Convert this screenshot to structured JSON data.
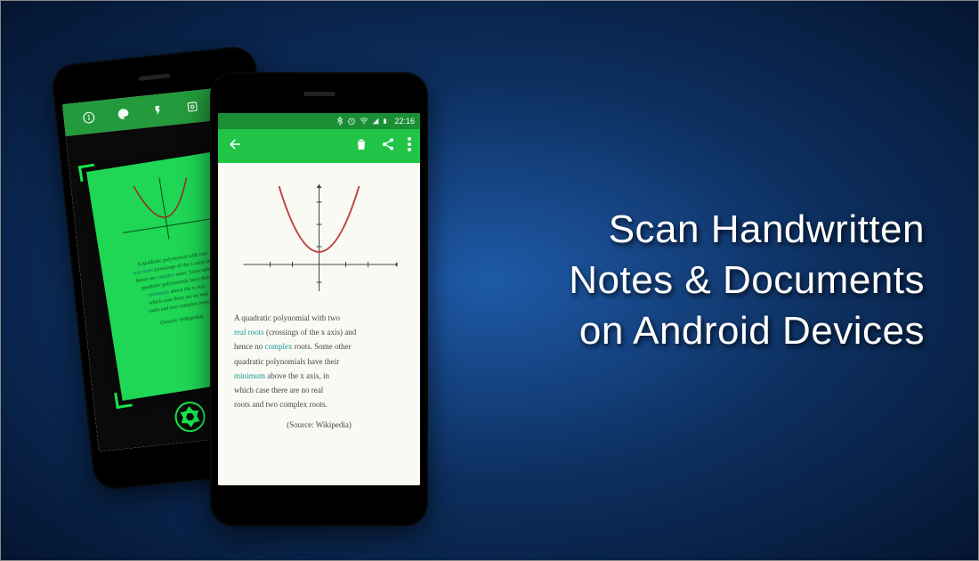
{
  "headline": {
    "line1": "Scan Handwritten",
    "line2": "Notes & Documents",
    "line3": "on Android Devices"
  },
  "phone1": {
    "note_l1": "A quadratic polynomial with two",
    "note_l2a": "real roots",
    "note_l2b": " (crossings of the x axis) and",
    "note_l3a": "hence no ",
    "note_l3b": "complex",
    "note_l3c": " roots. Some other",
    "note_l4": "quadratic polynomials have their",
    "note_l5a": "minimum",
    "note_l5b": " above the x axis,",
    "note_l6": "which case there are no real",
    "note_l7": "roots and two complex roots.",
    "source": "(Source: Wikipedia)"
  },
  "phone2": {
    "time": "22:16",
    "note_l1": "A quadratic polynomial with two",
    "note_l2a": "real roots",
    "note_l2b": " (crossings of the x axis) and",
    "note_l3a": "hence no ",
    "note_l3b": "complex",
    "note_l3c": " roots. Some other",
    "note_l4": "quadratic polynomials have their",
    "note_l5a": "minimum",
    "note_l5b": " above the x axis, in",
    "note_l6": "which case there are no real",
    "note_l7": "roots and two complex roots.",
    "source": "(Source: Wikipedia)"
  }
}
